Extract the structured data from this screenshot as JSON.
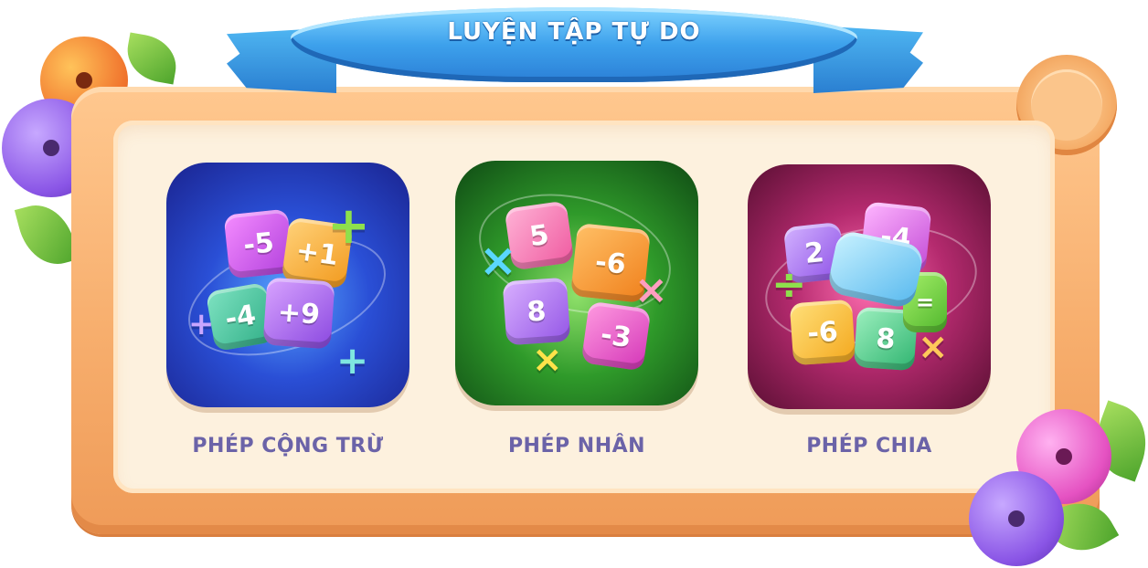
{
  "header": {
    "title": "LUYỆN TẬP TỰ DO"
  },
  "cards": [
    {
      "label": "PHÉP CỘNG TRỪ",
      "cubes": [
        "-5",
        "+1",
        "-4",
        "+9"
      ],
      "symbols": [
        "+",
        "+",
        "+"
      ]
    },
    {
      "label": "PHÉP NHÂN",
      "cubes": [
        "5",
        "-6",
        "8",
        "-3"
      ],
      "symbols": [
        "×",
        "×",
        "×"
      ]
    },
    {
      "label": "PHÉP CHIA",
      "cubes": [
        "2",
        "-4",
        "-6",
        "8",
        "="
      ],
      "symbols": [
        "÷",
        "×"
      ]
    }
  ],
  "colors": {
    "ribbon": "#3da1ec",
    "frame": "#f7ae6d",
    "board": "#fdf1de",
    "label": "#6b63a8",
    "card_add": "#2a4fd6",
    "card_mul": "#2f9a2a",
    "card_div": "#b42a6e"
  },
  "icons": [
    "berry-icon",
    "leaf-icon",
    "scroll-knob-icon"
  ]
}
